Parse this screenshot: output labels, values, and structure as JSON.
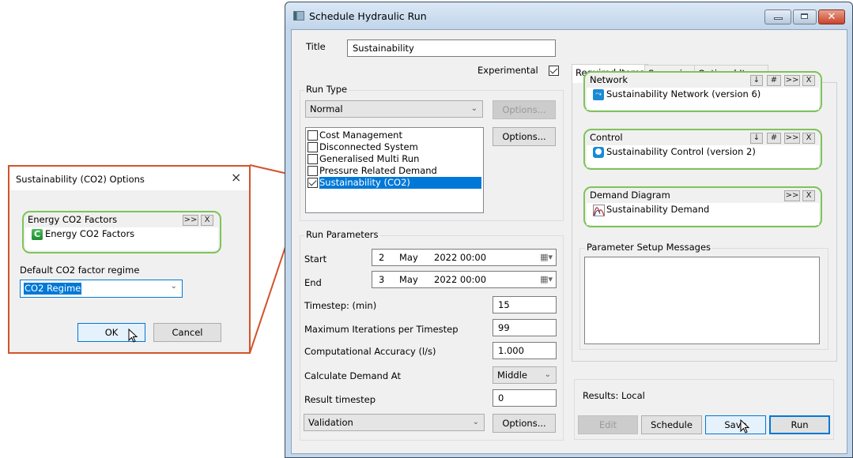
{
  "window": {
    "title": "Schedule Hydraulic Run",
    "controls": {
      "minimize": "minimize",
      "maximize": "maximize",
      "close": "close"
    }
  },
  "form": {
    "title_label": "Title",
    "title_value": "Sustainability",
    "experimental_label": "Experimental",
    "experimental_checked": true
  },
  "run_type": {
    "group_label": "Run Type",
    "selected": "Normal",
    "options_button": "Options...",
    "options_button_enabled": false,
    "list_options_button": "Options...",
    "items": [
      {
        "label": "Cost Management",
        "checked": false,
        "selected": false
      },
      {
        "label": "Disconnected System",
        "checked": false,
        "selected": false
      },
      {
        "label": "Generalised Multi Run",
        "checked": false,
        "selected": false
      },
      {
        "label": "Pressure Related Demand",
        "checked": false,
        "selected": false
      },
      {
        "label": "Sustainability (CO2)",
        "checked": true,
        "selected": true
      }
    ]
  },
  "run_parameters": {
    "group_label": "Run Parameters",
    "start_label": "Start",
    "start": {
      "day": "2",
      "month": "May",
      "year_time": "2022  00:00"
    },
    "end_label": "End",
    "end": {
      "day": "3",
      "month": "May",
      "year_time": "2022  00:00"
    },
    "timestep_label": "Timestep: (min)",
    "timestep_value": "15",
    "max_iter_label": "Maximum Iterations per Timestep",
    "max_iter_value": "99",
    "accuracy_label": "Computational Accuracy (l/s)",
    "accuracy_value": "1.000",
    "demand_at_label": "Calculate Demand At",
    "demand_at_value": "Middle",
    "result_timestep_label": "Result timestep",
    "result_timestep_value": "0",
    "validation_value": "Validation",
    "validation_options_button": "Options..."
  },
  "tabs": [
    {
      "label": "Required Items",
      "active": true
    },
    {
      "label": "Scenarios",
      "active": false
    },
    {
      "label": "Optional Items",
      "active": false
    }
  ],
  "required_items": {
    "network": {
      "label": "Network",
      "item": "Sustainability Network (version 6)",
      "buttons": [
        "↓",
        "#",
        ">>",
        "X"
      ]
    },
    "control": {
      "label": "Control",
      "item": "Sustainability Control (version 2)",
      "buttons": [
        "↓",
        "#",
        ">>",
        "X"
      ]
    },
    "demand": {
      "label": "Demand Diagram",
      "item": "Sustainability Demand",
      "buttons": [
        ">>",
        "X"
      ]
    }
  },
  "messages": {
    "label": "Parameter Setup Messages",
    "text": ""
  },
  "results": {
    "label": "Results: Local"
  },
  "actions": {
    "edit": "Edit",
    "schedule": "Schedule",
    "save": "Save",
    "run": "Run"
  },
  "options_dialog": {
    "title": "Sustainability (CO2) Options",
    "close": "×",
    "slot_label": "Energy CO2 Factors",
    "slot_item": "Energy CO2 Factors",
    "slot_buttons": [
      ">>",
      "X"
    ],
    "regime_label": "Default CO2 factor regime",
    "regime_value": "CO2 Regime",
    "ok": "OK",
    "cancel": "Cancel"
  },
  "colors": {
    "callout": "#d2532a",
    "slot_border": "#7ec45a",
    "selection": "#0078d7"
  }
}
